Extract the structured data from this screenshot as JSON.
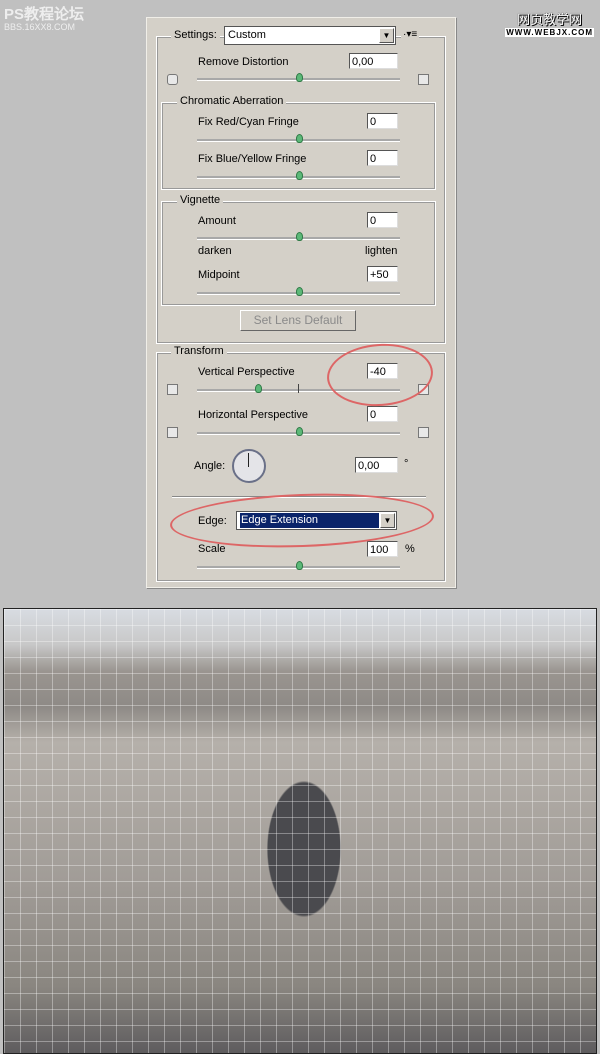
{
  "watermarks": {
    "left_title": "PS教程论坛",
    "left_sub": "BBS.16XX8.COM",
    "right_title": "网页教学网",
    "right_sub": "WWW.WEBJX.COM"
  },
  "settings": {
    "label": "Settings:",
    "value": "Custom",
    "menu_icon": "flyout-menu-icon"
  },
  "remove_distortion": {
    "label": "Remove Distortion",
    "value": "0,00",
    "slider_fraction": 0.5
  },
  "chromatic": {
    "title": "Chromatic Aberration",
    "red_cyan": {
      "label": "Fix Red/Cyan Fringe",
      "value": "0",
      "slider_fraction": 0.5
    },
    "blue_yellow": {
      "label": "Fix Blue/Yellow Fringe",
      "value": "0",
      "slider_fraction": 0.5
    }
  },
  "vignette": {
    "title": "Vignette",
    "amount": {
      "label": "Amount",
      "value": "0",
      "slider_fraction": 0.5
    },
    "darken": "darken",
    "lighten": "lighten",
    "midpoint": {
      "label": "Midpoint",
      "value": "+50",
      "slider_fraction": 0.5
    }
  },
  "set_lens_default": "Set Lens Default",
  "transform": {
    "title": "Transform",
    "vertical": {
      "label": "Vertical Perspective",
      "value": "-40",
      "slider_fraction": 0.3
    },
    "horizontal": {
      "label": "Horizontal Perspective",
      "value": "0",
      "slider_fraction": 0.5
    },
    "angle": {
      "label": "Angle:",
      "value": "0,00",
      "unit": "°"
    },
    "edge": {
      "label": "Edge:",
      "value": "Edge Extension"
    },
    "scale": {
      "label": "Scale",
      "value": "100",
      "unit": "%",
      "slider_fraction": 0.5
    }
  },
  "colors": {
    "highlight_ellipse": "#d66666",
    "selection": "#0a246a"
  }
}
